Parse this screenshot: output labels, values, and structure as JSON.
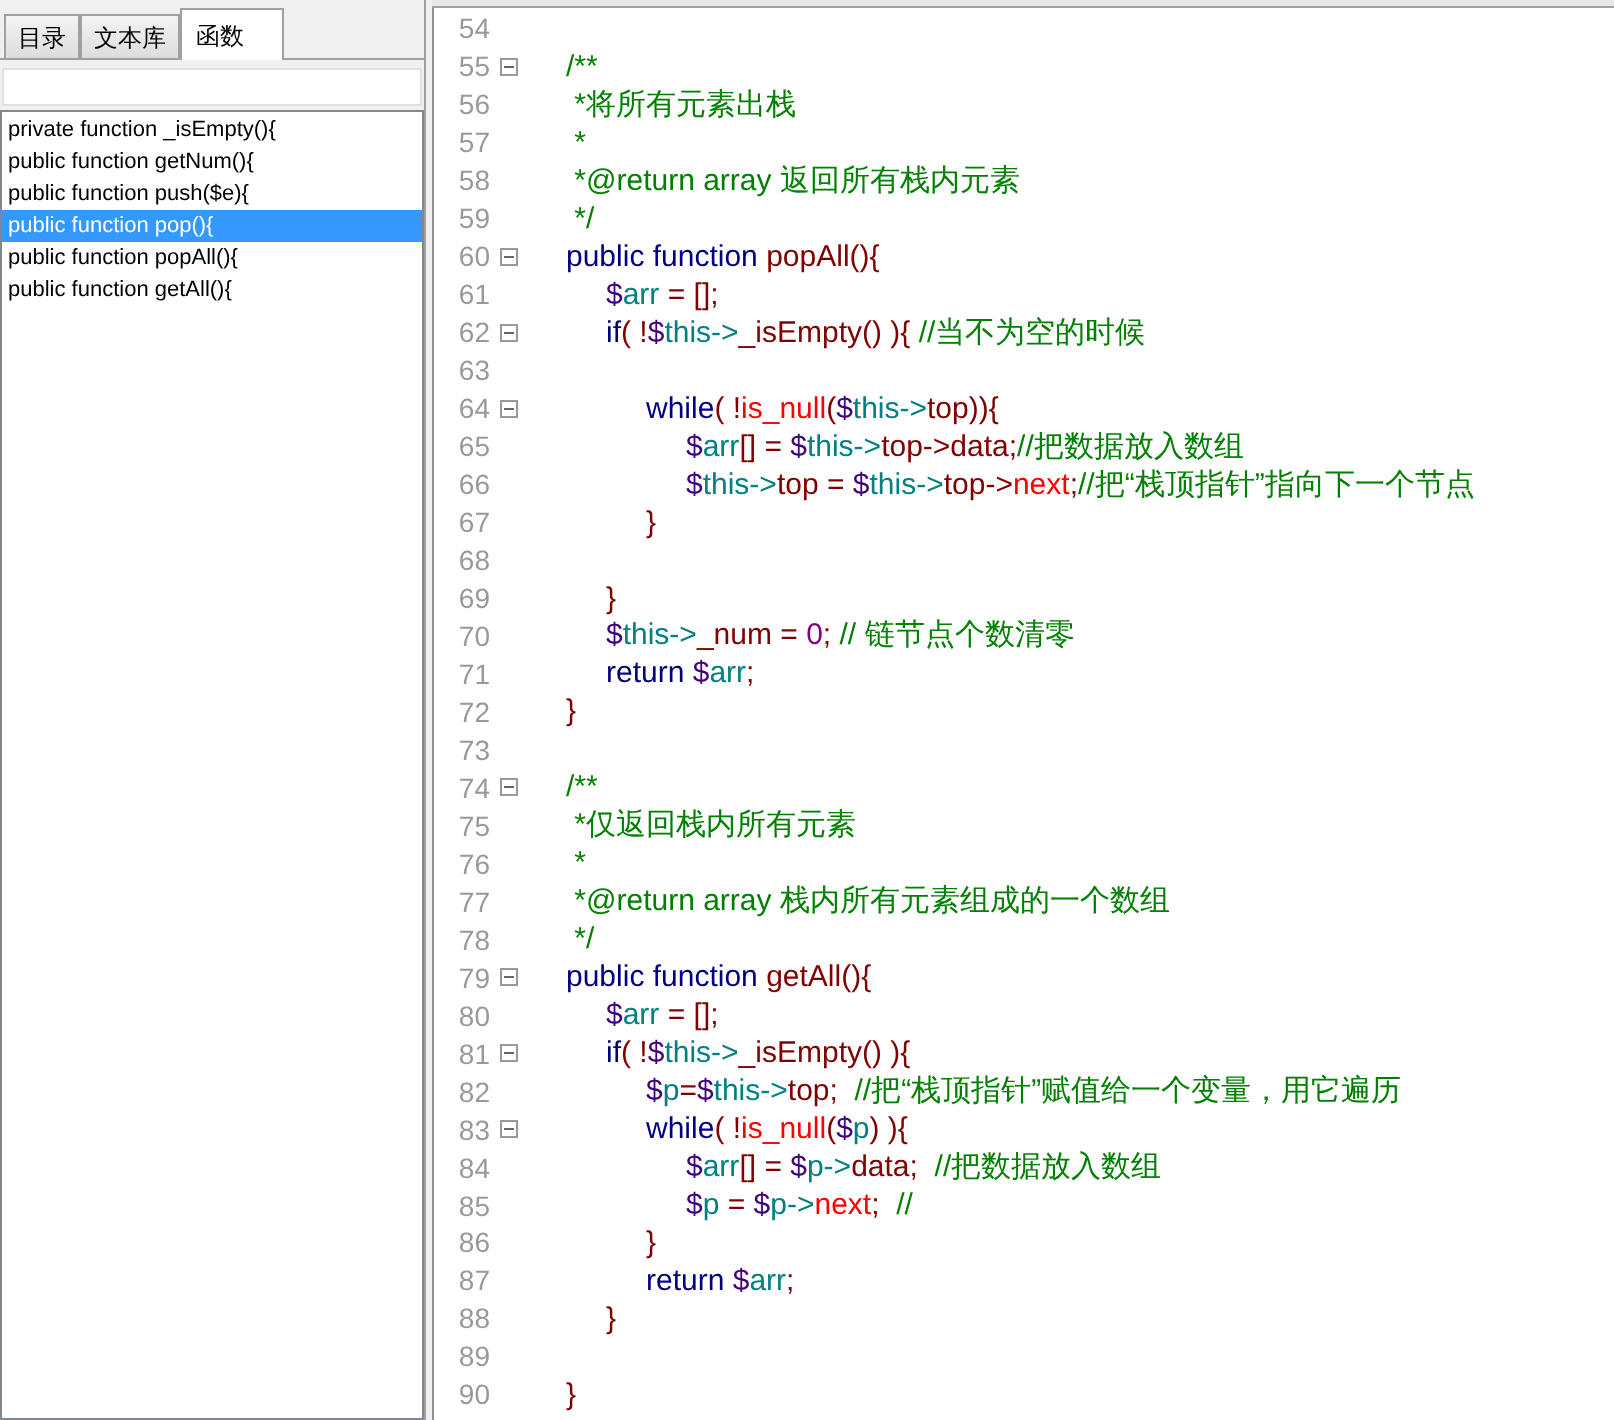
{
  "sidebar": {
    "tabs": [
      {
        "label": "目录",
        "selected": false
      },
      {
        "label": "文本库",
        "selected": false
      },
      {
        "label": "函数",
        "selected": true
      }
    ],
    "items": [
      {
        "label": "private function _isEmpty(){",
        "selected": false
      },
      {
        "label": "public function getNum(){",
        "selected": false
      },
      {
        "label": "public function push($e){",
        "selected": false
      },
      {
        "label": "public function pop(){",
        "selected": true
      },
      {
        "label": "public function popAll(){",
        "selected": false
      },
      {
        "label": "public function getAll(){",
        "selected": false
      }
    ]
  },
  "editor": {
    "lines": [
      {
        "number": "54",
        "fold": false
      },
      {
        "number": "55",
        "fold": true,
        "tokens": [
          {
            "kind": "comment",
            "text": "\t/**"
          }
        ]
      },
      {
        "number": "56",
        "fold": false,
        "tokens": [
          {
            "kind": "comment",
            "text": "\t *将所有元素出栈"
          }
        ]
      },
      {
        "number": "57",
        "fold": false,
        "tokens": [
          {
            "kind": "comment",
            "text": "\t *"
          }
        ]
      },
      {
        "number": "58",
        "fold": false,
        "tokens": [
          {
            "kind": "comment",
            "text": "\t *@return array 返回所有栈内元素"
          }
        ]
      },
      {
        "number": "59",
        "fold": false,
        "tokens": [
          {
            "kind": "comment",
            "text": "\t */"
          }
        ]
      },
      {
        "number": "60",
        "fold": true,
        "tokens": [
          {
            "kind": "keyword",
            "text": "\tpublic function "
          },
          {
            "kind": "member",
            "text": "popAll(){"
          }
        ]
      },
      {
        "number": "61",
        "fold": false,
        "tokens": [
          {
            "kind": "sigil",
            "text": "\t\t$"
          },
          {
            "kind": "variable",
            "text": "arr"
          },
          {
            "kind": "operator",
            "text": " = [];"
          }
        ]
      },
      {
        "number": "62",
        "fold": true,
        "tokens": [
          {
            "kind": "keyword",
            "text": "\t\tif"
          },
          {
            "kind": "operator",
            "text": "( !"
          },
          {
            "kind": "sigil",
            "text": "$"
          },
          {
            "kind": "variable",
            "text": "this->"
          },
          {
            "kind": "member",
            "text": "_isEmpty() ){ "
          },
          {
            "kind": "comment",
            "text": "//当不为空的时候"
          }
        ]
      },
      {
        "number": "63",
        "fold": false
      },
      {
        "number": "64",
        "fold": true,
        "tokens": [
          {
            "kind": "keyword",
            "text": "\t\t\twhile"
          },
          {
            "kind": "operator",
            "text": "( !"
          },
          {
            "kind": "builtin",
            "text": "is_null"
          },
          {
            "kind": "operator",
            "text": "("
          },
          {
            "kind": "sigil",
            "text": "$"
          },
          {
            "kind": "variable",
            "text": "this->"
          },
          {
            "kind": "member",
            "text": "top)){"
          }
        ]
      },
      {
        "number": "65",
        "fold": false,
        "tokens": [
          {
            "kind": "sigil",
            "text": "\t\t\t\t$"
          },
          {
            "kind": "variable",
            "text": "arr"
          },
          {
            "kind": "operator",
            "text": "[] = "
          },
          {
            "kind": "sigil",
            "text": "$"
          },
          {
            "kind": "variable",
            "text": "this->"
          },
          {
            "kind": "member",
            "text": "top->data;"
          },
          {
            "kind": "comment",
            "text": "//把数据放入数组"
          }
        ]
      },
      {
        "number": "66",
        "fold": false,
        "tokens": [
          {
            "kind": "sigil",
            "text": "\t\t\t\t$"
          },
          {
            "kind": "variable",
            "text": "this->"
          },
          {
            "kind": "member",
            "text": "top = "
          },
          {
            "kind": "sigil",
            "text": "$"
          },
          {
            "kind": "variable",
            "text": "this->"
          },
          {
            "kind": "member",
            "text": "top->"
          },
          {
            "kind": "builtin",
            "text": "next"
          },
          {
            "kind": "operator",
            "text": ";"
          },
          {
            "kind": "comment",
            "text": "//把“栈顶指针”指向下一个节点"
          }
        ]
      },
      {
        "number": "67",
        "fold": false,
        "tokens": [
          {
            "kind": "operator",
            "text": "\t\t\t}"
          }
        ]
      },
      {
        "number": "68",
        "fold": false
      },
      {
        "number": "69",
        "fold": false,
        "tokens": [
          {
            "kind": "operator",
            "text": "\t\t}"
          }
        ]
      },
      {
        "number": "70",
        "fold": false,
        "tokens": [
          {
            "kind": "sigil",
            "text": "\t\t$"
          },
          {
            "kind": "variable",
            "text": "this->"
          },
          {
            "kind": "member",
            "text": "_num = "
          },
          {
            "kind": "number",
            "text": "0"
          },
          {
            "kind": "operator",
            "text": "; "
          },
          {
            "kind": "comment",
            "text": "// 链节点个数清零"
          }
        ]
      },
      {
        "number": "71",
        "fold": false,
        "tokens": [
          {
            "kind": "keyword",
            "text": "\t\treturn "
          },
          {
            "kind": "sigil",
            "text": "$"
          },
          {
            "kind": "variable",
            "text": "arr"
          },
          {
            "kind": "operator",
            "text": ";"
          }
        ]
      },
      {
        "number": "72",
        "fold": false,
        "tokens": [
          {
            "kind": "operator",
            "text": "\t}"
          }
        ]
      },
      {
        "number": "73",
        "fold": false
      },
      {
        "number": "74",
        "fold": true,
        "tokens": [
          {
            "kind": "comment",
            "text": "\t/**"
          }
        ]
      },
      {
        "number": "75",
        "fold": false,
        "tokens": [
          {
            "kind": "comment",
            "text": "\t *仅返回栈内所有元素"
          }
        ]
      },
      {
        "number": "76",
        "fold": false,
        "tokens": [
          {
            "kind": "comment",
            "text": "\t *"
          }
        ]
      },
      {
        "number": "77",
        "fold": false,
        "tokens": [
          {
            "kind": "comment",
            "text": "\t *@return array 栈内所有元素组成的一个数组"
          }
        ]
      },
      {
        "number": "78",
        "fold": false,
        "tokens": [
          {
            "kind": "comment",
            "text": "\t */"
          }
        ]
      },
      {
        "number": "79",
        "fold": true,
        "tokens": [
          {
            "kind": "keyword",
            "text": "\tpublic function "
          },
          {
            "kind": "member",
            "text": "getAll(){"
          }
        ]
      },
      {
        "number": "80",
        "fold": false,
        "tokens": [
          {
            "kind": "sigil",
            "text": "\t\t$"
          },
          {
            "kind": "variable",
            "text": "arr"
          },
          {
            "kind": "operator",
            "text": " = [];"
          }
        ]
      },
      {
        "number": "81",
        "fold": true,
        "tokens": [
          {
            "kind": "keyword",
            "text": "\t\tif"
          },
          {
            "kind": "operator",
            "text": "( !"
          },
          {
            "kind": "sigil",
            "text": "$"
          },
          {
            "kind": "variable",
            "text": "this->"
          },
          {
            "kind": "member",
            "text": "_isEmpty() ){"
          }
        ]
      },
      {
        "number": "82",
        "fold": false,
        "tokens": [
          {
            "kind": "sigil",
            "text": "\t\t\t$"
          },
          {
            "kind": "variable",
            "text": "p"
          },
          {
            "kind": "operator",
            "text": "="
          },
          {
            "kind": "sigil",
            "text": "$"
          },
          {
            "kind": "variable",
            "text": "this->"
          },
          {
            "kind": "member",
            "text": "top;  "
          },
          {
            "kind": "comment",
            "text": "//把“栈顶指针”赋值给一个变量，用它遍历"
          }
        ]
      },
      {
        "number": "83",
        "fold": true,
        "tokens": [
          {
            "kind": "keyword",
            "text": "\t\t\twhile"
          },
          {
            "kind": "operator",
            "text": "( !"
          },
          {
            "kind": "builtin",
            "text": "is_null"
          },
          {
            "kind": "operator",
            "text": "("
          },
          {
            "kind": "sigil",
            "text": "$"
          },
          {
            "kind": "variable",
            "text": "p"
          },
          {
            "kind": "operator",
            "text": ") ){"
          }
        ]
      },
      {
        "number": "84",
        "fold": false,
        "tokens": [
          {
            "kind": "sigil",
            "text": "\t\t\t\t$"
          },
          {
            "kind": "variable",
            "text": "arr"
          },
          {
            "kind": "operator",
            "text": "[] = "
          },
          {
            "kind": "sigil",
            "text": "$"
          },
          {
            "kind": "variable",
            "text": "p->"
          },
          {
            "kind": "member",
            "text": "data;  "
          },
          {
            "kind": "comment",
            "text": "//把数据放入数组"
          }
        ]
      },
      {
        "number": "85",
        "fold": false,
        "tokens": [
          {
            "kind": "sigil",
            "text": "\t\t\t\t$"
          },
          {
            "kind": "variable",
            "text": "p"
          },
          {
            "kind": "operator",
            "text": " = "
          },
          {
            "kind": "sigil",
            "text": "$"
          },
          {
            "kind": "variable",
            "text": "p->"
          },
          {
            "kind": "builtin",
            "text": "next"
          },
          {
            "kind": "operator",
            "text": ";  "
          },
          {
            "kind": "comment",
            "text": "//"
          }
        ]
      },
      {
        "number": "86",
        "fold": false,
        "tokens": [
          {
            "kind": "operator",
            "text": "\t\t\t}"
          }
        ]
      },
      {
        "number": "87",
        "fold": false,
        "tokens": [
          {
            "kind": "keyword",
            "text": "\t\t\treturn "
          },
          {
            "kind": "sigil",
            "text": "$"
          },
          {
            "kind": "variable",
            "text": "arr"
          },
          {
            "kind": "operator",
            "text": ";"
          }
        ]
      },
      {
        "number": "88",
        "fold": false,
        "tokens": [
          {
            "kind": "operator",
            "text": "\t\t}"
          }
        ]
      },
      {
        "number": "89",
        "fold": false
      },
      {
        "number": "90",
        "fold": false,
        "tokens": [
          {
            "kind": "operator",
            "text": "\t}"
          }
        ]
      }
    ]
  }
}
